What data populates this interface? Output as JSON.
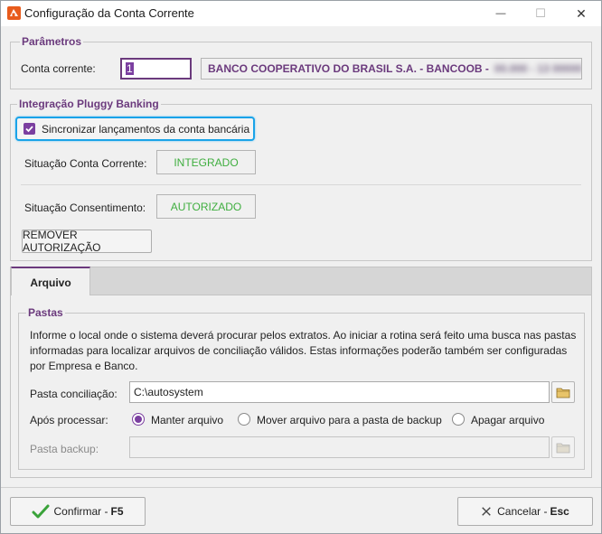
{
  "window": {
    "title": "Configuração da Conta Corrente",
    "minimize_glyph": "—",
    "maximize_glyph": "☐",
    "close_glyph": "✕"
  },
  "parametros": {
    "title": "Parâmetros",
    "conta_label": "Conta corrente:",
    "conta_value": "1",
    "bank_name": "BANCO COOPERATIVO DO BRASIL S.A. - BANCOOB -",
    "bank_extra": "00.000 - 13 00000"
  },
  "pluggy": {
    "title": "Integração Pluggy Banking",
    "sync_label": "Sincronizar lançamentos da conta bancária",
    "sync_checked": true,
    "situacao_conta_label": "Situação Conta Corrente:",
    "situacao_conta_value": "INTEGRADO",
    "situacao_consentimento_label": "Situação Consentimento:",
    "situacao_consentimento_value": "AUTORIZADO",
    "remover_label": "REMOVER AUTORIZAÇÃO"
  },
  "tabs": [
    {
      "label": "Arquivo",
      "active": true
    }
  ],
  "pastas": {
    "title": "Pastas",
    "description_line1": "Informe o local onde o sistema deverá procurar pelos extratos. Ao iniciar a rotina será feito uma busca nas pastas",
    "description_line2": "informadas para localizar arquivos de conciliação válidos. Estas informações poderão também ser configuradas",
    "description_line3": "por Empresa e Banco.",
    "conciliacao_label": "Pasta conciliação:",
    "conciliacao_value": "C:\\autosystem",
    "apos_label": "Após processar:",
    "options": [
      {
        "label": "Manter arquivo",
        "selected": true
      },
      {
        "label": "Mover arquivo para a pasta de backup",
        "selected": false
      },
      {
        "label": "Apagar arquivo",
        "selected": false
      }
    ],
    "backup_label": "Pasta backup:",
    "backup_value": ""
  },
  "footer": {
    "confirm_label": "Confirmar -",
    "confirm_key": "F5",
    "cancel_label": "Cancelar -",
    "cancel_key": "Esc"
  },
  "colors": {
    "accent": "#6b3a7d",
    "status_green": "#3fae3f",
    "focus_blue": "#1aa3e8"
  }
}
